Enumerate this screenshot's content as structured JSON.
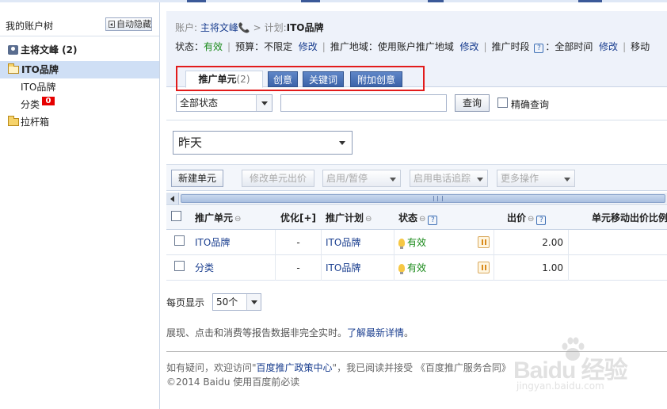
{
  "sidebar": {
    "title": "我的账户树",
    "hide_button": "自动隐藏",
    "account": "主将文峰 (2)",
    "plan": "ITO品牌",
    "units": [
      {
        "label": "ITO品牌"
      },
      {
        "label": "分类",
        "badge": "0"
      }
    ],
    "trash": "拉杆箱"
  },
  "header": {
    "crumb_account_label": "账户:",
    "crumb_account": "主将文峰",
    "crumb_sep": ">",
    "crumb_plan_label": "计划:",
    "crumb_plan": "ITO品牌",
    "status_label": "状态：",
    "status_value": "有效",
    "budget_label": "预算：",
    "budget_value": "不限定",
    "edit_label": "修改",
    "region_label": "推广地域：",
    "region_value": "使用账户推广地域",
    "schedule_label": "推广时段",
    "schedule_value": "：全部时间",
    "mobile_label": "移动"
  },
  "tabs": {
    "unit": "推广单元",
    "unit_count": "(2)",
    "creative": "创意",
    "keyword": "关键词",
    "extra": "附加创意"
  },
  "filter": {
    "status_select": "全部状态",
    "search_value": "",
    "query_button": "查询",
    "exact_label": "精确查询"
  },
  "date_select": "昨天",
  "toolbar": {
    "new_unit": "新建单元",
    "edit_bid": "修改单元出价",
    "enable_pause": "启用/暂停",
    "phone_track": "启用电话追踪",
    "more": "更多操作"
  },
  "table": {
    "headers": {
      "unit": "推广单元",
      "optimize": "优化[+]",
      "plan": "推广计划",
      "status": "状态",
      "bid": "出价",
      "mobile_ratio": "单元移动出价比例"
    },
    "rows": [
      {
        "unit": "ITO品牌",
        "optimize": "-",
        "plan": "ITO品牌",
        "status": "有效",
        "bid": "2.00"
      },
      {
        "unit": "分类",
        "optimize": "-",
        "plan": "ITO品牌",
        "status": "有效",
        "bid": "1.00"
      }
    ]
  },
  "paging": {
    "per_page_label": "每页显示",
    "per_page_value": "50个"
  },
  "note": {
    "text": "展现、点击和消费等报告数据非完全实时。",
    "link": "了解最新详情",
    "end": "。"
  },
  "footer": {
    "line1_pre": "如有疑问，欢迎访问\"",
    "line1_link": "百度推广政策中心",
    "line1_post": "\"，我已阅读并接受 《百度推广服务合同》",
    "line2": "©2014 Baidu 使用百度前必读"
  },
  "watermark": {
    "brand": "Baidu 经验",
    "url": "jingyan.baidu.com"
  },
  "colors": {
    "accent_blue": "#3c63a9",
    "status_green": "#1a8a1a",
    "highlight_red": "#e21b1b",
    "badge_red": "#e60000",
    "link_blue": "#1a3e8f"
  }
}
